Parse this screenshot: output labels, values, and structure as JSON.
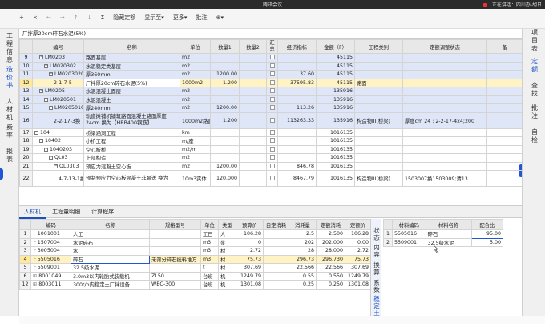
{
  "app": {
    "title": "腾讯会议",
    "sharing_status": "正在讲话：四川办-胡日"
  },
  "toolbar": {
    "add": "+",
    "close": "×",
    "back": "←",
    "forward": "→",
    "up": "↑",
    "down": "↓",
    "sum": "Σ",
    "hide_quota": "隐藏定额",
    "show_to": "显示至▾",
    "more": "更多▾",
    "annotate": "批注",
    "extra": "⊕▾"
  },
  "left_nav": [
    "工程信息",
    "造价书",
    "人材机",
    "费率",
    "报表"
  ],
  "right_nav": [
    "项目表",
    "定额",
    "查找",
    "批注",
    "自检"
  ],
  "formula_bar": "厂拌厚20cm碎石水泥(5%)",
  "main_table": {
    "headers": [
      "",
      "编号",
      "名称",
      "单位",
      "数量1",
      "数量2",
      "汇总",
      "经济指标",
      "金额（F）",
      "工程类别",
      "定额调整状态",
      "备"
    ],
    "rows": [
      {
        "rn": "9",
        "code": "LM0203",
        "name": "路面基层",
        "unit": "m2",
        "q1": "",
        "index": "",
        "amount": "45115",
        "cat": "",
        "adj": "",
        "indent": 1,
        "box": "−"
      },
      {
        "rn": "10",
        "code": "LM020302",
        "name": "水泥稳定类基层",
        "unit": "m2",
        "q1": "",
        "index": "",
        "amount": "45115",
        "cat": "",
        "adj": "",
        "indent": 2,
        "box": "−"
      },
      {
        "rn": "11",
        "code": "LM02030201",
        "name": "厚360mm",
        "unit": "m2",
        "q1": "1200.00",
        "index": "37.60",
        "amount": "45115",
        "cat": "",
        "adj": "",
        "indent": 3,
        "box": "−"
      },
      {
        "rn": "12",
        "code": "2-1-7-5",
        "name": "厂拌厚20cm碎石水泥(5%)",
        "unit": "1000m2",
        "q1": "1.200",
        "index": "37595.83",
        "amount": "45115",
        "cat": "路面",
        "adj": "",
        "indent": 4,
        "box": ""
      },
      {
        "rn": "13",
        "code": "LM0205",
        "name": "水泥混凝土面层",
        "unit": "m2",
        "q1": "",
        "index": "",
        "amount": "135916",
        "cat": "",
        "adj": "",
        "indent": 1,
        "box": "−"
      },
      {
        "rn": "14",
        "code": "LM020501",
        "name": "水泥混凝土",
        "unit": "m2",
        "q1": "",
        "index": "",
        "amount": "135916",
        "cat": "",
        "adj": "",
        "indent": 2,
        "box": "−"
      },
      {
        "rn": "15",
        "code": "LM02050101",
        "name": "厚240mm",
        "unit": "m2",
        "q1": "1200.00",
        "index": "113.26",
        "amount": "135916",
        "cat": "",
        "adj": "",
        "indent": 3,
        "box": "−"
      },
      {
        "rn": "16",
        "code": "2-2-17-3换",
        "name": "轨道摊铺机铺筑路面混凝土路面厚度24cm 换为【HRB400钢筋】",
        "unit": "1000m2路面",
        "q1": "1.200",
        "index": "113263.33",
        "amount": "135916",
        "cat": "构造物III(桥梁)",
        "adj": "厚度cm 24 : 2-2-17-4x4;200",
        "indent": 4,
        "box": "",
        "tall": true
      },
      {
        "rn": "17",
        "code": "104",
        "name": "桥梁涵洞工程",
        "unit": "km",
        "q1": "",
        "index": "",
        "amount": "1016135",
        "cat": "",
        "adj": "",
        "indent": 0,
        "box": "−"
      },
      {
        "rn": "18",
        "code": "10402",
        "name": "小桥工程",
        "unit": "m/座",
        "q1": "",
        "index": "",
        "amount": "1016135",
        "cat": "",
        "adj": "",
        "indent": 1,
        "box": "−"
      },
      {
        "rn": "19",
        "code": "1040203",
        "name": "空心板桥",
        "unit": "m2/m",
        "q1": "",
        "index": "",
        "amount": "1016135",
        "cat": "",
        "adj": "",
        "indent": 2,
        "box": "−"
      },
      {
        "rn": "20",
        "code": "QL03",
        "name": "上部构造",
        "unit": "m2",
        "q1": "",
        "index": "",
        "amount": "1016135",
        "cat": "",
        "adj": "",
        "indent": 3,
        "box": "−"
      },
      {
        "rn": "21",
        "code": "QL0303",
        "name": "预应力混凝土空心板",
        "unit": "m2",
        "q1": "1200.00",
        "index": "846.78",
        "amount": "1016135",
        "cat": "",
        "adj": "",
        "indent": 4,
        "box": "−"
      },
      {
        "rn": "22",
        "code": "4-7-13-1换",
        "name": "预制预应力空心板混凝土非泵送 换为",
        "unit": "10m3实体",
        "q1": "120.000",
        "index": "8467.79",
        "amount": "1016135",
        "cat": "构造物III(桥梁)",
        "adj": "1503007换1503009;清13",
        "indent": 5,
        "box": "",
        "tall": true
      }
    ]
  },
  "bottom_tabs": [
    "人材机",
    "工程量明细",
    "计算程序"
  ],
  "rcj_table": {
    "headers": [
      "",
      "编码",
      "名称",
      "规格型号",
      "单位",
      "类型",
      "预算价",
      "自定消耗",
      "消耗量",
      "定额消耗",
      "定额价"
    ],
    "rows": [
      {
        "rn": "1",
        "code": "1001001",
        "name": "人工",
        "spec": "",
        "unit": "工日",
        "type": "人",
        "price": "106.28",
        "custom": "",
        "qty": "2.5",
        "dqty": "2.500",
        "dprice": "106.28",
        "tree": "┌"
      },
      {
        "rn": "2",
        "code": "1507004",
        "name": "水泥碎石",
        "spec": "",
        "unit": "m3",
        "type": "浆",
        "price": "0",
        "custom": "",
        "qty": "202",
        "dqty": "202.000",
        "dprice": "0.00",
        "tree": "├"
      },
      {
        "rn": "3",
        "code": "3005004",
        "name": "水",
        "spec": "",
        "unit": "m3",
        "type": "材",
        "price": "2.72",
        "custom": "",
        "qty": "28",
        "dqty": "28.000",
        "dprice": "2.72",
        "tree": "├"
      },
      {
        "rn": "4",
        "code": "5505016",
        "name": "碎石",
        "spec": "未筛分碎石统料堆方",
        "unit": "m3",
        "type": "材",
        "price": "75.73",
        "custom": "",
        "qty": "296.73",
        "dqty": "296.730",
        "dprice": "75.73",
        "tree": "├"
      },
      {
        "rn": "5",
        "code": "5509001",
        "name": "32.5级水泥",
        "spec": "",
        "unit": "t",
        "type": "材",
        "price": "307.69",
        "custom": "",
        "qty": "22.566",
        "dqty": "22.566",
        "dprice": "307.69",
        "tree": "├"
      },
      {
        "rn": "6",
        "code": "8001049",
        "name": "3.0m3以内轮胎式装载机",
        "spec": "ZL50",
        "unit": "台班",
        "type": "机",
        "price": "1249.79",
        "custom": "",
        "qty": "0.55",
        "dqty": "0.550",
        "dprice": "1249.79",
        "tree": "⊞"
      },
      {
        "rn": "12",
        "code": "8003011",
        "name": "300t/h内稳定土厂拌设备",
        "spec": "WBC-300",
        "unit": "台班",
        "type": "机",
        "price": "1301.08",
        "custom": "",
        "qty": "0.25",
        "dqty": "0.250",
        "dprice": "1301.08",
        "tree": "⊞"
      }
    ]
  },
  "side_tabs": [
    "状态",
    "内容",
    "换算",
    "系数",
    "稳定土"
  ],
  "ratio_table": {
    "headers": [
      "",
      "材料编码",
      "材料名称",
      "配合比"
    ],
    "rows": [
      {
        "rn": "1",
        "code": "5505016",
        "name": "碎石",
        "ratio": "95.00"
      },
      {
        "rn": "2",
        "code": "5509001",
        "name": "32.5级水泥",
        "ratio": "5.00"
      }
    ]
  },
  "colors": {
    "accent": "#2254d6",
    "row_highlight": "#dfe6f7",
    "row_selected": "#fff3c4"
  }
}
